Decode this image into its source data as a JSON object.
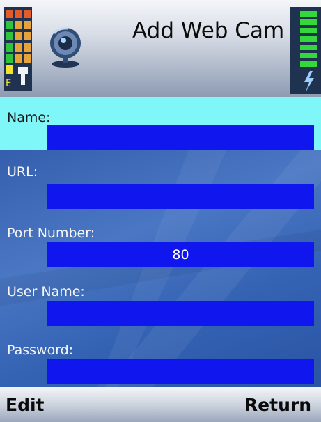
{
  "header": {
    "title": "Add Web Cam",
    "icons": [
      "signal-strength-icon",
      "webcam-icon",
      "battery-icon"
    ]
  },
  "form": {
    "fields": [
      {
        "label": "Name:",
        "value": "",
        "focused": true
      },
      {
        "label": "URL:",
        "value": ""
      },
      {
        "label": "Port Number:",
        "value": "80"
      },
      {
        "label": "User Name:",
        "value": ""
      },
      {
        "label": "Password:",
        "value": ""
      }
    ]
  },
  "softkeys": {
    "left": "Edit",
    "right": "Return"
  },
  "colors": {
    "input_fill": "#0f16ee",
    "focus_highlight": "#7ff6f8",
    "background": "#3a64b0"
  }
}
